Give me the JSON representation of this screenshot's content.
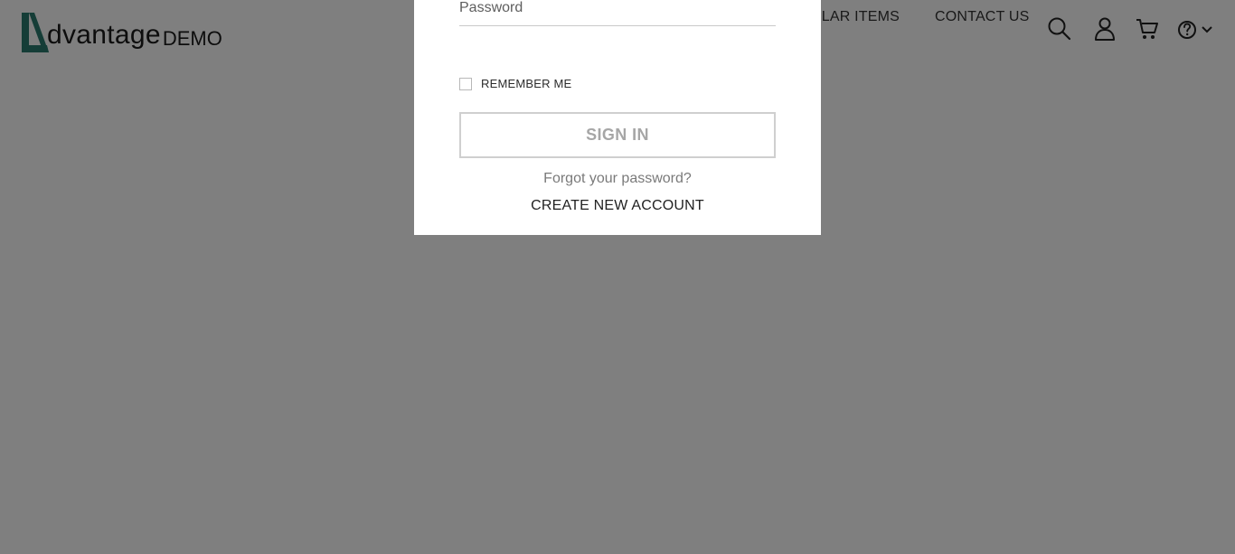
{
  "header": {
    "logo": {
      "word": "dvantage",
      "suffix": "DEMO",
      "accent_color": "#2a7a6f"
    },
    "nav": {
      "popular_items": "POPULAR ITEMS",
      "contact_us": "CONTACT US"
    },
    "icons": [
      "search-icon",
      "user-icon",
      "cart-icon",
      "help-icon",
      "chevron-down-icon"
    ]
  },
  "modal": {
    "password_placeholder": "Password",
    "remember_me": "REMEMBER ME",
    "sign_in": "SIGN IN",
    "forgot_password": "Forgot your password?",
    "create_account": "CREATE NEW ACCOUNT"
  },
  "colors": {
    "overlay": "rgba(0,0,0,0.5)",
    "signin_border": "#cfcfcf",
    "signin_text": "#a6a6a6"
  }
}
